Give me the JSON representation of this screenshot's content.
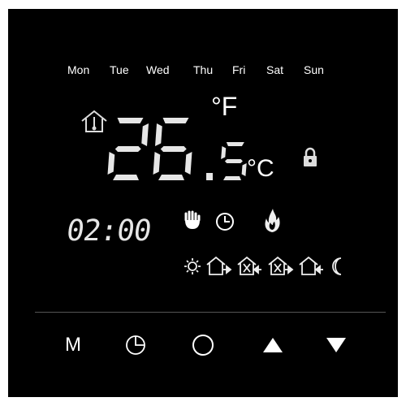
{
  "days": [
    "Mon",
    "Tue",
    "Wed",
    "Thu",
    "Fri",
    "Sat",
    "Sun"
  ],
  "temperature": {
    "integer": "26",
    "decimal": "5",
    "unit_f": "°F",
    "unit_c": "°C"
  },
  "clock": "02:00",
  "status_icons": [
    "house-thermometer-icon",
    "lock-icon",
    "hand-icon",
    "clock-icon",
    "flame-icon"
  ],
  "schedule_icons": [
    "sun-icon",
    "house-leave-icon",
    "house-return-icon",
    "house-leave-icon",
    "house-return-icon",
    "moon-icon"
  ],
  "buttons": {
    "mode_label": "M",
    "schedule": "clock-icon",
    "power": "power-icon",
    "up": "up-arrow-icon",
    "down": "down-arrow-icon"
  },
  "colors": {
    "background": "#000000",
    "segment": "#e6e6e6",
    "text": "#ffffff"
  }
}
